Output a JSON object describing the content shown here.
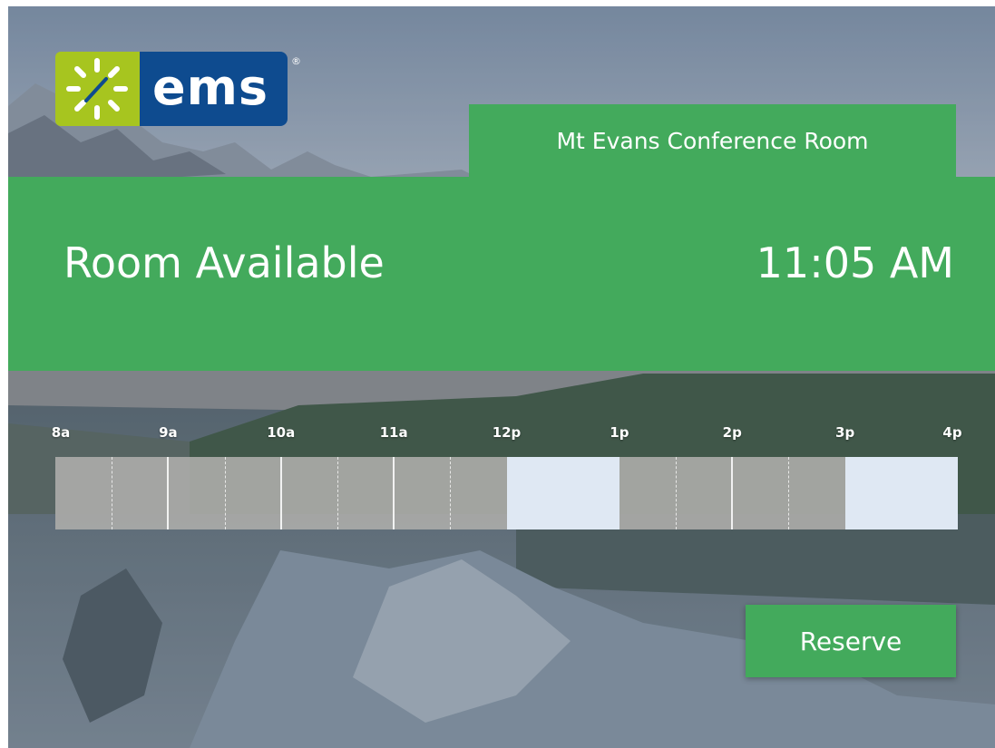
{
  "logo": {
    "text": "ems",
    "registered": "®",
    "icon": "sun-clock-icon",
    "mark_color": "#a7c51f",
    "word_color": "#0e4b8f"
  },
  "room": {
    "name": "Mt Evans Conference Room"
  },
  "status": {
    "text": "Room Available",
    "time": "11:05 AM",
    "color": "#43aa5c"
  },
  "timeline": {
    "hours": [
      "8a",
      "9a",
      "10a",
      "11a",
      "12p",
      "1p",
      "2p",
      "3p",
      "4p"
    ],
    "slots": [
      {
        "start": "8a",
        "end": "12p",
        "state": "booked"
      },
      {
        "start": "12p",
        "end": "1p",
        "state": "free"
      },
      {
        "start": "1p",
        "end": "3p",
        "state": "booked"
      },
      {
        "start": "3p",
        "end": "4p",
        "state": "free"
      }
    ]
  },
  "actions": {
    "reserve_label": "Reserve"
  }
}
